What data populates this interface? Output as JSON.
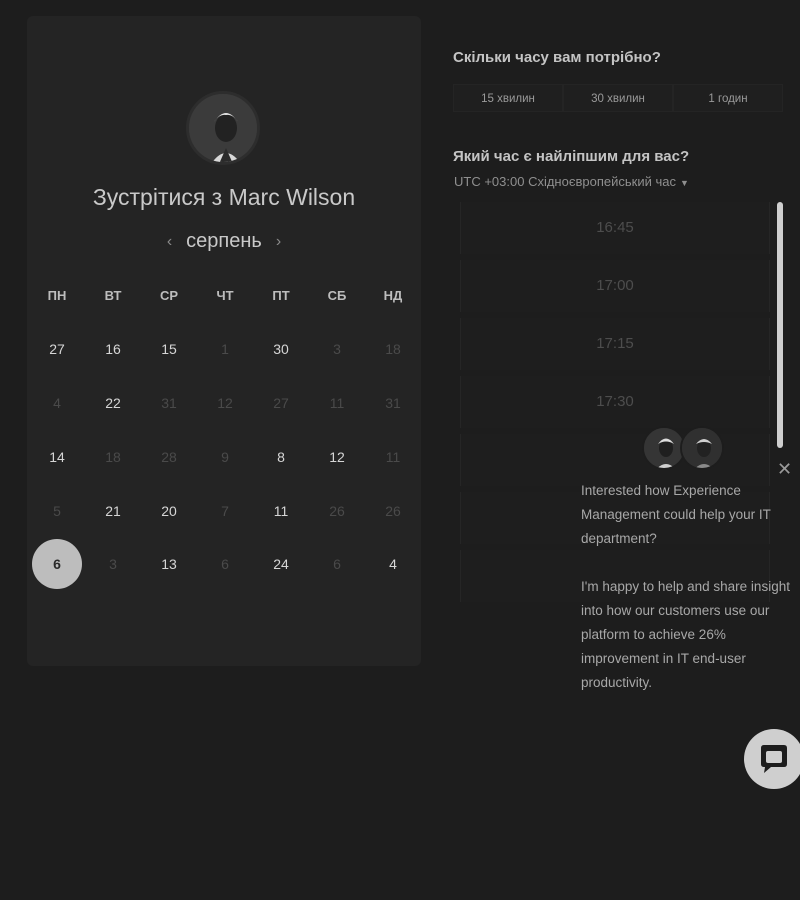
{
  "booking": {
    "title": "Зустрітися з Marc Wilson",
    "month": "серпень",
    "prev_icon": "chevron-left-icon",
    "next_icon": "chevron-right-icon"
  },
  "calendar": {
    "weekdays": [
      "ПН",
      "ВТ",
      "СР",
      "ЧТ",
      "ПТ",
      "СБ",
      "НД"
    ],
    "weeks": [
      [
        "27",
        "16",
        "15",
        "1",
        "30",
        "3",
        "18"
      ],
      [
        "4",
        "22",
        "31",
        "12",
        "27",
        "11",
        "31"
      ],
      [
        "14",
        "18",
        "28",
        "9",
        "8",
        "12",
        "11"
      ],
      [
        "5",
        "21",
        "20",
        "7",
        "11",
        "26",
        "26"
      ],
      [
        "6",
        "3",
        "13",
        "6",
        "24",
        "6",
        "4"
      ]
    ],
    "selected": "6"
  },
  "duration": {
    "question": "Скільки часу вам потрібно?",
    "options": [
      "15 хвилин",
      "30 хвилин",
      "1 годин"
    ]
  },
  "time": {
    "question": "Який час є найліпшим для вас?",
    "timezone": "UTC +03:00 Східноєвропейський час",
    "slots": [
      "16:45",
      "17:00",
      "17:15",
      "17:30",
      "",
      "",
      ""
    ]
  },
  "chat": {
    "message_1": "Interested how Experience Management could help your IT department?",
    "message_2": "I'm happy to help and share insight into how our customers use our platform to achieve 26% improvement in IT end-user productivity."
  },
  "colors": {
    "background": "#1d1d1d",
    "card": "#242424",
    "selected_day": "#bdbdbd"
  }
}
